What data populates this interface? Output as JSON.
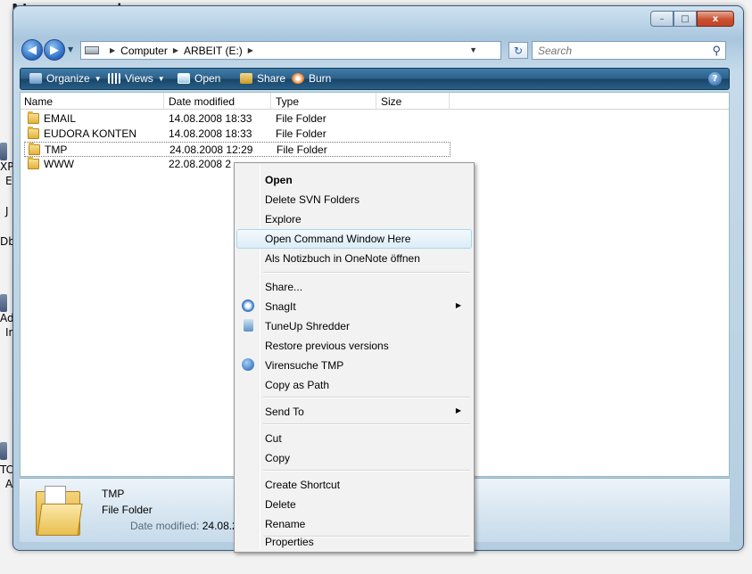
{
  "desktop": {
    "title_fragment": "Ne... ... place",
    "labels": [
      "XP",
      "E",
      "J",
      "Dbg",
      "Ad",
      "In",
      "TC",
      "A"
    ]
  },
  "window": {
    "controls": {
      "minimize": "–",
      "maximize": "□",
      "close": "x"
    }
  },
  "address": {
    "crumbs": [
      "Computer",
      "ARBEIT (E:)"
    ],
    "search_placeholder": "Search"
  },
  "toolbar": {
    "items": [
      {
        "label": "Organize",
        "icon": "organize-icon",
        "has_dropdown": true
      },
      {
        "label": "Views",
        "icon": "views-icon",
        "has_dropdown": true
      },
      {
        "label": "Open",
        "icon": "open-icon",
        "has_dropdown": false
      },
      {
        "label": "Share",
        "icon": "share-icon",
        "has_dropdown": false
      },
      {
        "label": "Burn",
        "icon": "burn-icon",
        "has_dropdown": false
      }
    ],
    "help": "?"
  },
  "files": {
    "columns": [
      "Name",
      "Date modified",
      "Type",
      "Size"
    ],
    "rows": [
      {
        "name": "EMAIL",
        "date": "14.08.2008 18:33",
        "type": "File Folder",
        "size": ""
      },
      {
        "name": "EUDORA KONTEN",
        "date": "14.08.2008 18:33",
        "type": "File Folder",
        "size": ""
      },
      {
        "name": "TMP",
        "date": "24.08.2008 12:29",
        "type": "File Folder",
        "size": "",
        "selected": true
      },
      {
        "name": "WWW",
        "date": "22.08.2008 2",
        "type": "",
        "size": ""
      }
    ]
  },
  "details": {
    "name": "TMP",
    "type": "File Folder",
    "modified_label": "Date modified:",
    "modified_value": "24.08.2"
  },
  "context_menu": {
    "items": {
      "open": "Open",
      "delete_svn": "Delete SVN Folders",
      "explore": "Explore",
      "open_cmd": "Open Command Window Here",
      "onenote": "Als Notizbuch in OneNote öffnen",
      "share": "Share...",
      "snagit": "SnagIt",
      "tuneup": "TuneUp Shredder",
      "restore": "Restore previous versions",
      "virus": "Virensuche TMP",
      "copy_path": "Copy as Path",
      "send_to": "Send To",
      "cut": "Cut",
      "copy": "Copy",
      "create_shortcut": "Create Shortcut",
      "delete": "Delete",
      "rename": "Rename",
      "properties": "Properties"
    },
    "highlighted": "Open Command Window Here"
  },
  "colors": {
    "toolbar": "#2c5f88",
    "menu_highlight": "#dcedf7",
    "close_button": "#c9512f"
  }
}
